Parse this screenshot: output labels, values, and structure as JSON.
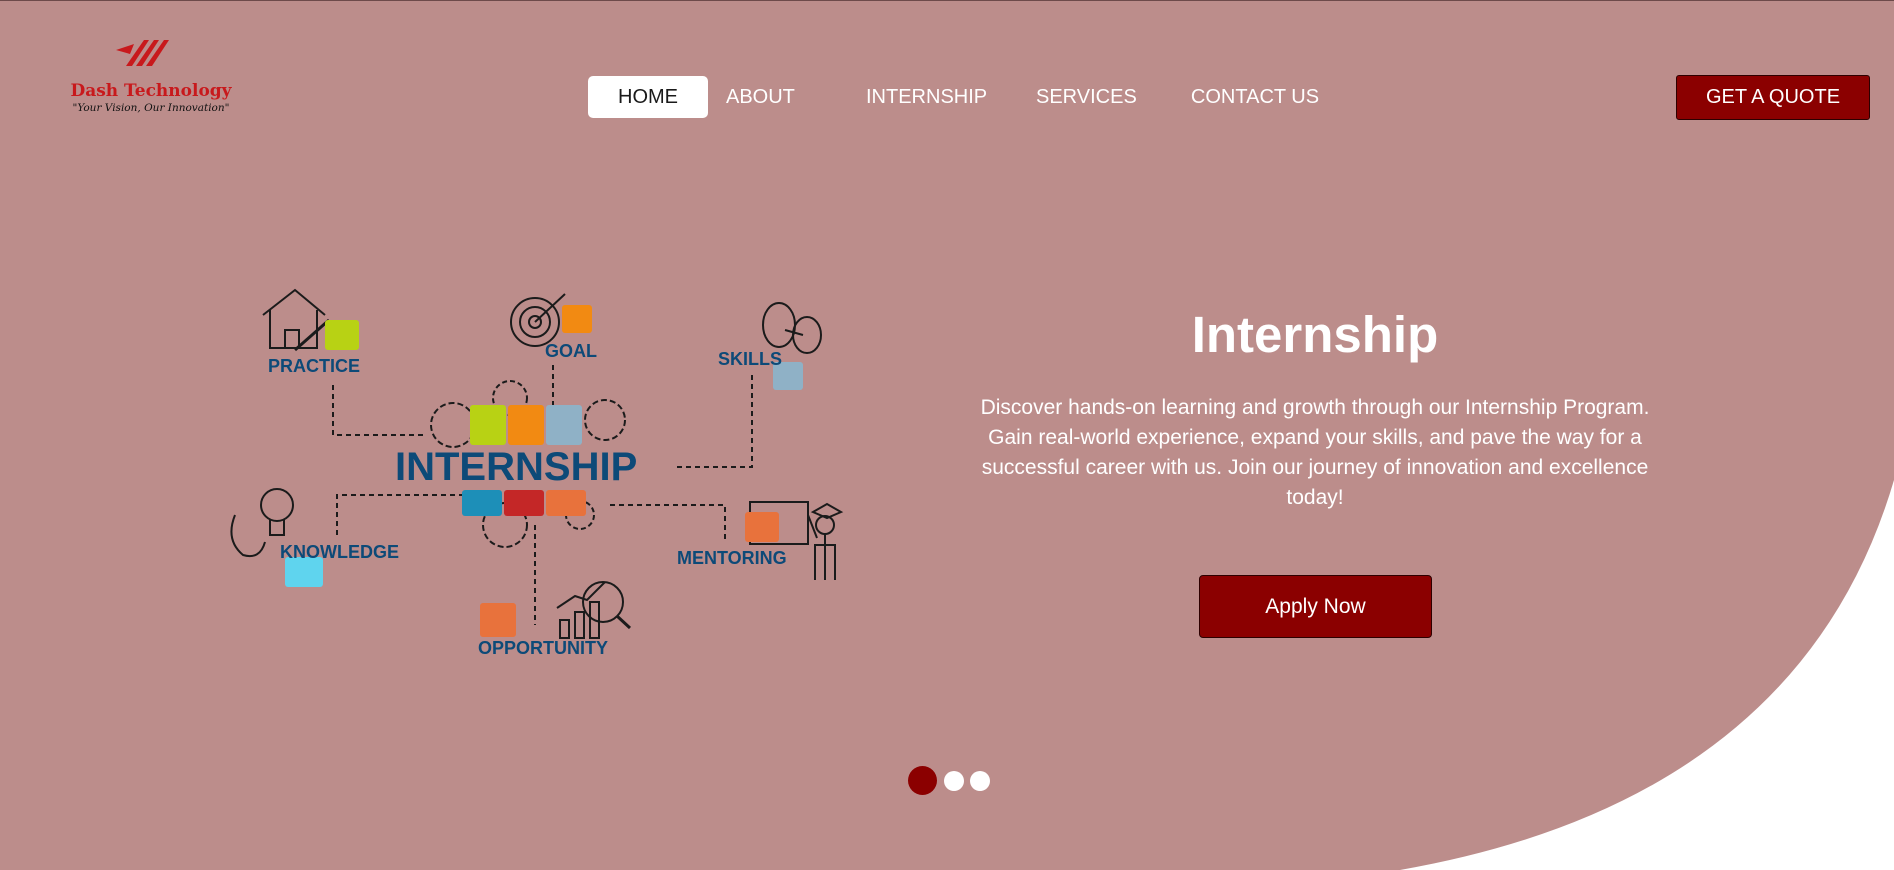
{
  "colors": {
    "hero_bg": "#bc8d8b",
    "page_bg": "#ffffff",
    "accent": "#8b0000",
    "brand_red": "#c8191c",
    "illustration_blue": "#0d4a78"
  },
  "logo": {
    "name": "Dash Technology",
    "tagline": "\"Your Vision, Our Innovation\"",
    "icon": "dash-logo-mark"
  },
  "nav": {
    "items": [
      {
        "label": "HOME",
        "active": true
      },
      {
        "label": "ABOUT",
        "active": false
      },
      {
        "label": "INTERNSHIP",
        "active": false
      },
      {
        "label": "SERVICES",
        "active": false
      },
      {
        "label": "CONTACT US",
        "active": false
      }
    ]
  },
  "header": {
    "quote_label": "GET A QUOTE"
  },
  "illustration": {
    "title": "INTERNSHIP",
    "labels": {
      "practice": "PRACTICE",
      "goal": "GOAL",
      "skills": "SKILLS",
      "knowledge": "KNOWLEDGE",
      "mentoring": "MENTORING",
      "opportunity": "OPPORTUNITY"
    }
  },
  "hero": {
    "title": "Internship",
    "description": "Discover hands-on learning and growth through our Internship Program. Gain real-world experience, expand your skills, and pave the way for a successful career with us. Join our journey of innovation and excellence today!",
    "cta_label": "Apply Now"
  },
  "carousel": {
    "slide_count": 3,
    "active_index": 0
  }
}
